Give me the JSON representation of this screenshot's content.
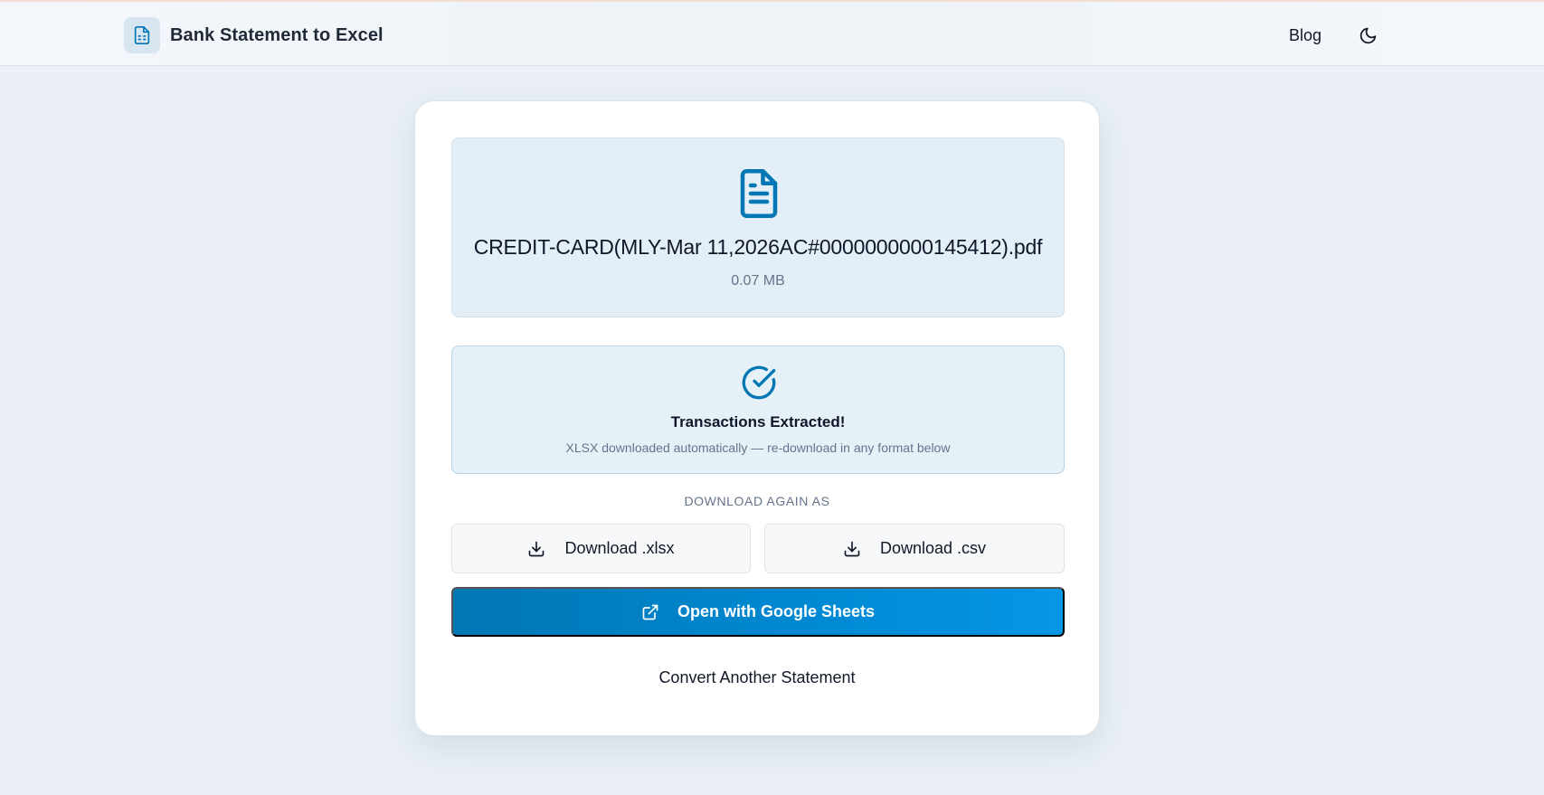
{
  "header": {
    "brand_title": "Bank Statement to Excel",
    "brand_icon": "spreadsheet-file-icon",
    "nav_blog": "Blog",
    "theme_toggle_icon": "moon-icon"
  },
  "file": {
    "icon": "document-icon",
    "name": "CREDIT-CARD(MLY-Mar 11,2026AC#0000000000145412).pdf",
    "size": "0.07 MB"
  },
  "status": {
    "icon": "check-circle-icon",
    "title": "Transactions Extracted!",
    "subtitle": "XLSX downloaded automatically — re-download in any format below"
  },
  "downloads": {
    "label": "DOWNLOAD AGAIN AS",
    "xlsx_label": "Download .xlsx",
    "csv_label": "Download .csv",
    "download_icon": "download-icon"
  },
  "sheets_button": {
    "label": "Open with Google Sheets",
    "icon": "external-link-icon"
  },
  "convert_another": "Convert Another Statement",
  "colors": {
    "accent": "#0284c7",
    "page_bg": "#eaf0f5",
    "card_bg": "#ffffff",
    "file_box_bg": "#e3eef6",
    "success_border": "#b6d2e6"
  }
}
